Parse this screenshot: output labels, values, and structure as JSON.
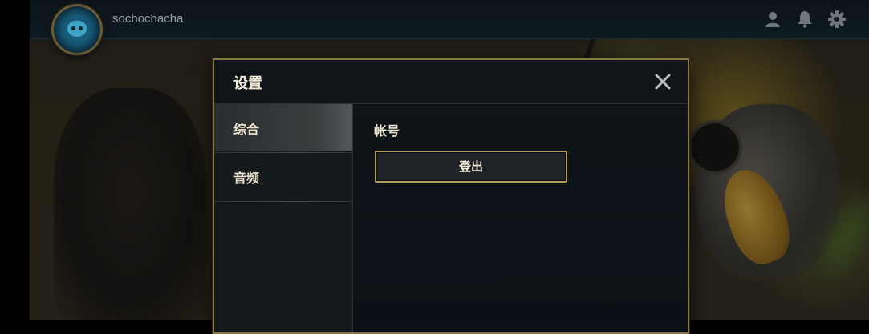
{
  "header": {
    "username": "sochochacha",
    "icons": [
      "user-icon",
      "bell-icon",
      "gear-icon"
    ]
  },
  "dialog": {
    "title": "设置",
    "close_icon": "close-icon",
    "sidebar": {
      "items": [
        {
          "label": "综合",
          "active": true
        },
        {
          "label": "音频",
          "active": false
        }
      ]
    },
    "content": {
      "section_label": "帐号",
      "logout_label": "登出"
    }
  },
  "colors": {
    "gold_border": "#8a7545",
    "button_border": "#b39a5e",
    "dialog_bg": "#0f1419",
    "text_cream": "#f2ead8"
  }
}
